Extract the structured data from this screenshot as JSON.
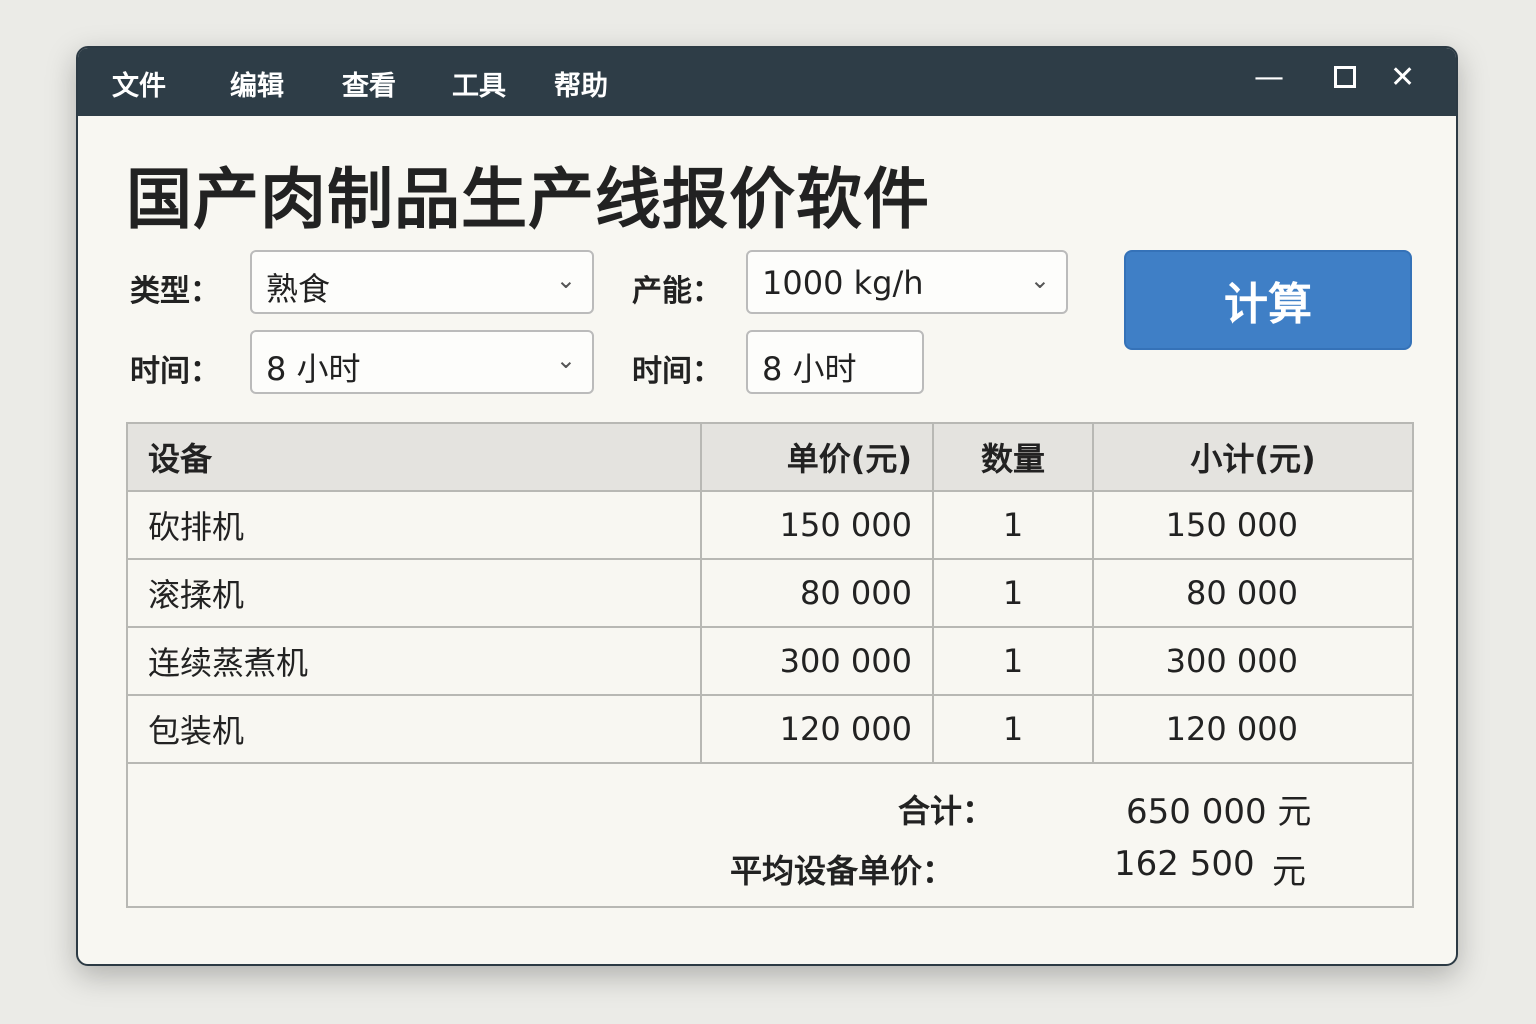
{
  "menu": [
    "文件",
    "编辑",
    "查看",
    "工具",
    "帮助"
  ],
  "title": "国产肉制品生产线报价软件",
  "form": {
    "type_label": "类型：",
    "type_value": "熟食",
    "capacity_label": "产能：",
    "capacity_value": "1000 kg/h",
    "time_label": "时间：",
    "time_value": "8 小时",
    "time2_label": "时间：",
    "time2_value": "8 小时"
  },
  "calc_label": "计算",
  "table": {
    "headers": [
      "设备",
      "单价(元)",
      "数量",
      "小计(元)"
    ],
    "rows": [
      [
        "砍排机",
        "150 000",
        "1",
        "150 000"
      ],
      [
        "滚揉机",
        "80 000",
        "1",
        "80 000"
      ],
      [
        "连续蒸煮机",
        "300 000",
        "1",
        "300 000"
      ],
      [
        "包装机",
        "120 000",
        "1",
        "120 000"
      ]
    ]
  },
  "totals": {
    "total_label": "合计：",
    "total_value": "650 000 元",
    "avg_label": "平均设备单价：",
    "avg_value": "162 500",
    "avg_unit": "元"
  }
}
